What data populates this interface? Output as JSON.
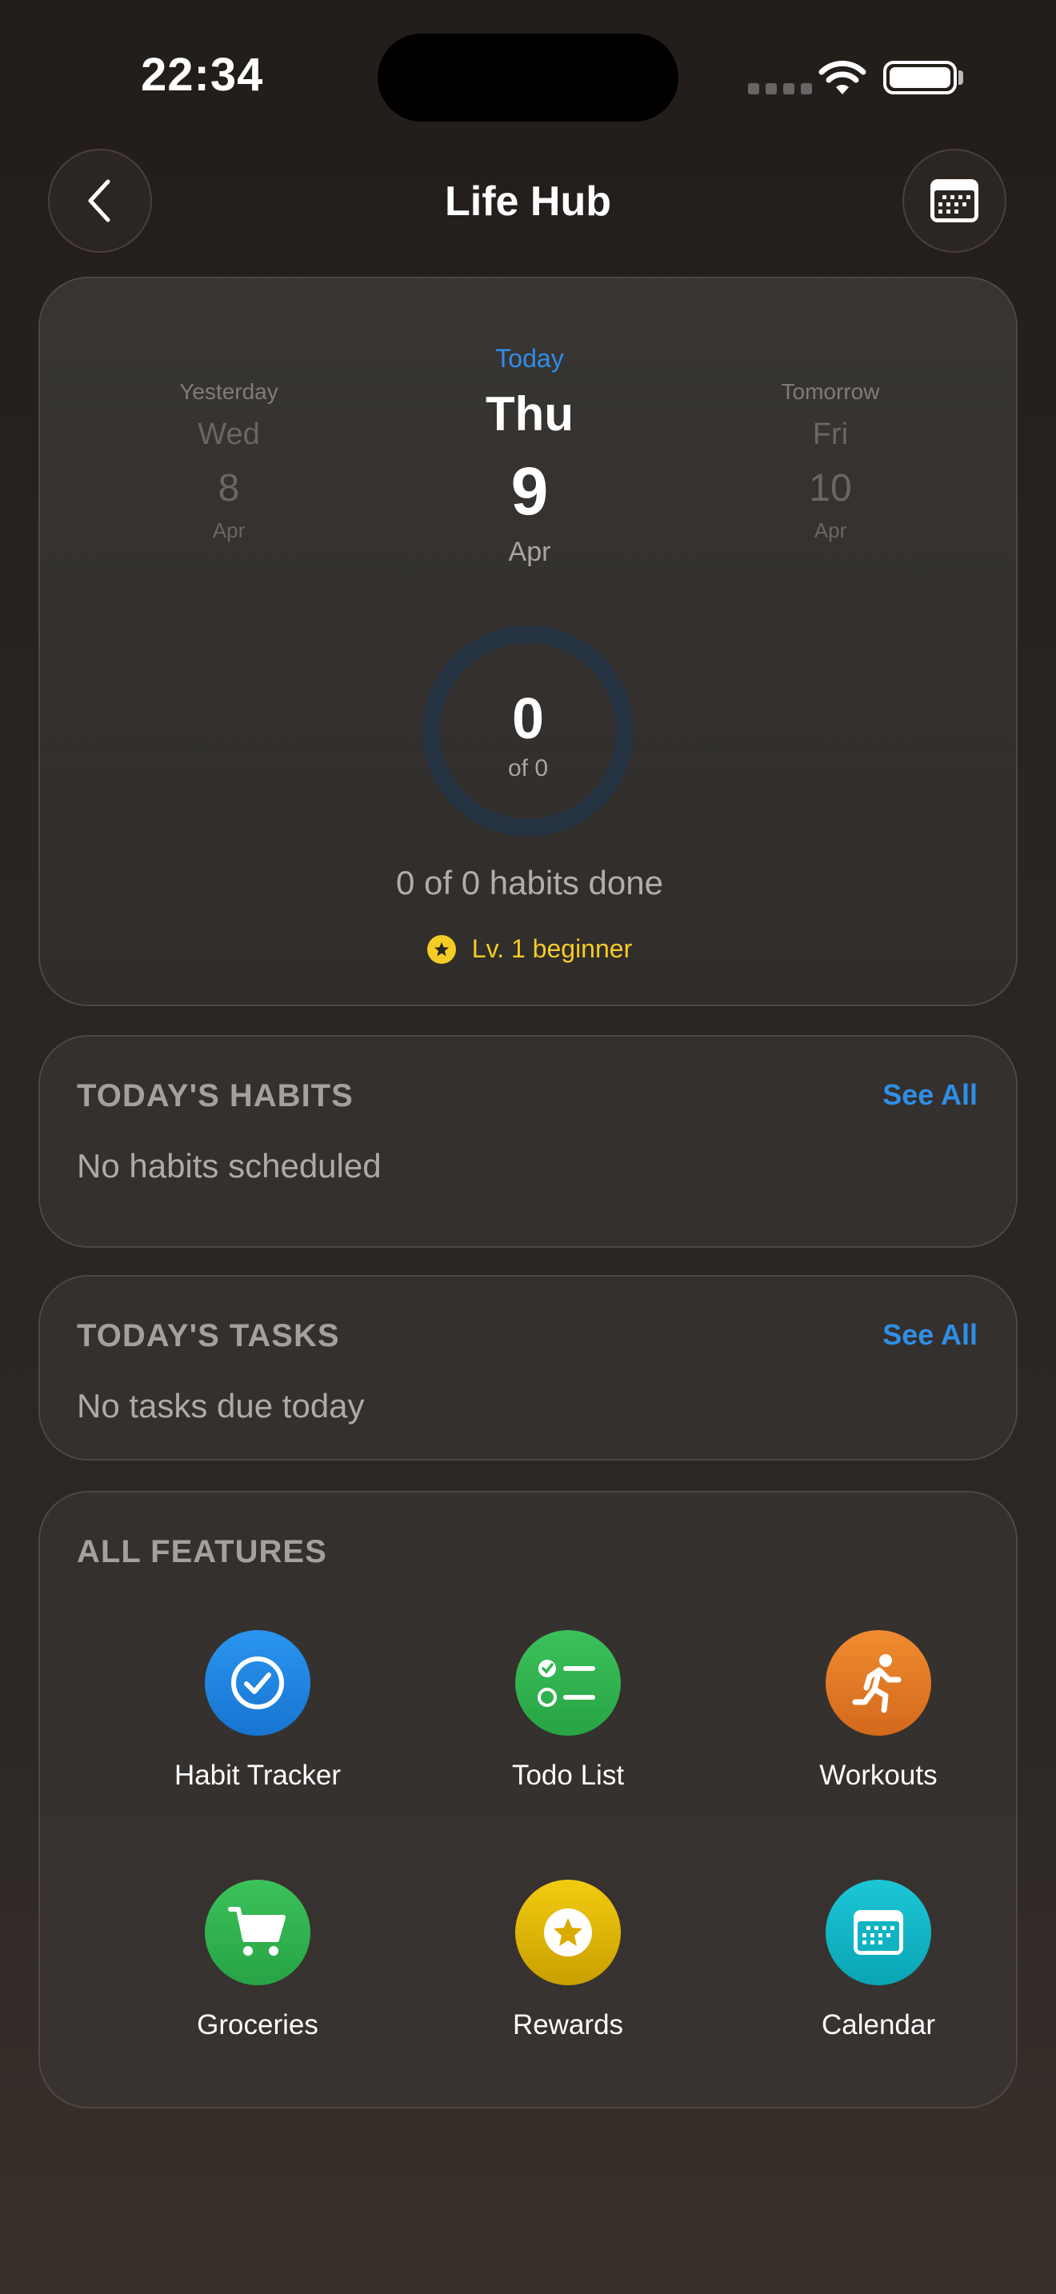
{
  "status_bar": {
    "time": "22:34",
    "icons": [
      "cellular-icon",
      "wifi-icon",
      "battery-icon"
    ]
  },
  "nav": {
    "title": "Life Hub",
    "back_icon": "chevron-left-icon",
    "calendar_icon": "calendar-icon"
  },
  "overview": {
    "days": {
      "yesterday": {
        "label": "Yesterday",
        "weekday": "Wed",
        "day": "8",
        "month": "Apr"
      },
      "today": {
        "label": "Today",
        "weekday": "Thu",
        "day": "9",
        "month": "Apr"
      },
      "tomorrow": {
        "label": "Tomorrow",
        "weekday": "Fri",
        "day": "10",
        "month": "Apr"
      }
    },
    "progress": {
      "count": "0",
      "of_label": "of 0",
      "fraction": 0
    },
    "habits_done": "0 of 0 habits done",
    "level": "Lv. 1 beginner",
    "level_color": "#f4cc25"
  },
  "habits_section": {
    "title": "TODAY'S HABITS",
    "see_all": "See All",
    "empty": "No habits scheduled"
  },
  "tasks_section": {
    "title": "TODAY'S TASKS",
    "see_all": "See All",
    "empty": "No tasks due today"
  },
  "features_section": {
    "title": "ALL FEATURES",
    "items": [
      {
        "label": "Habit Tracker",
        "icon": "check-circle-icon",
        "color": "#1f87e6"
      },
      {
        "label": "Todo List",
        "icon": "checklist-icon",
        "color": "#2fb54f"
      },
      {
        "label": "Workouts",
        "icon": "running-figure-icon",
        "color": "#e37a25"
      },
      {
        "label": "Groceries",
        "icon": "cart-icon",
        "color": "#2fb54f"
      },
      {
        "label": "Rewards",
        "icon": "star-icon",
        "color": "#e2b800"
      },
      {
        "label": "Calendar",
        "icon": "calendar-icon",
        "color": "#11b8c8"
      }
    ]
  },
  "accent_color": "#2f8ee8"
}
